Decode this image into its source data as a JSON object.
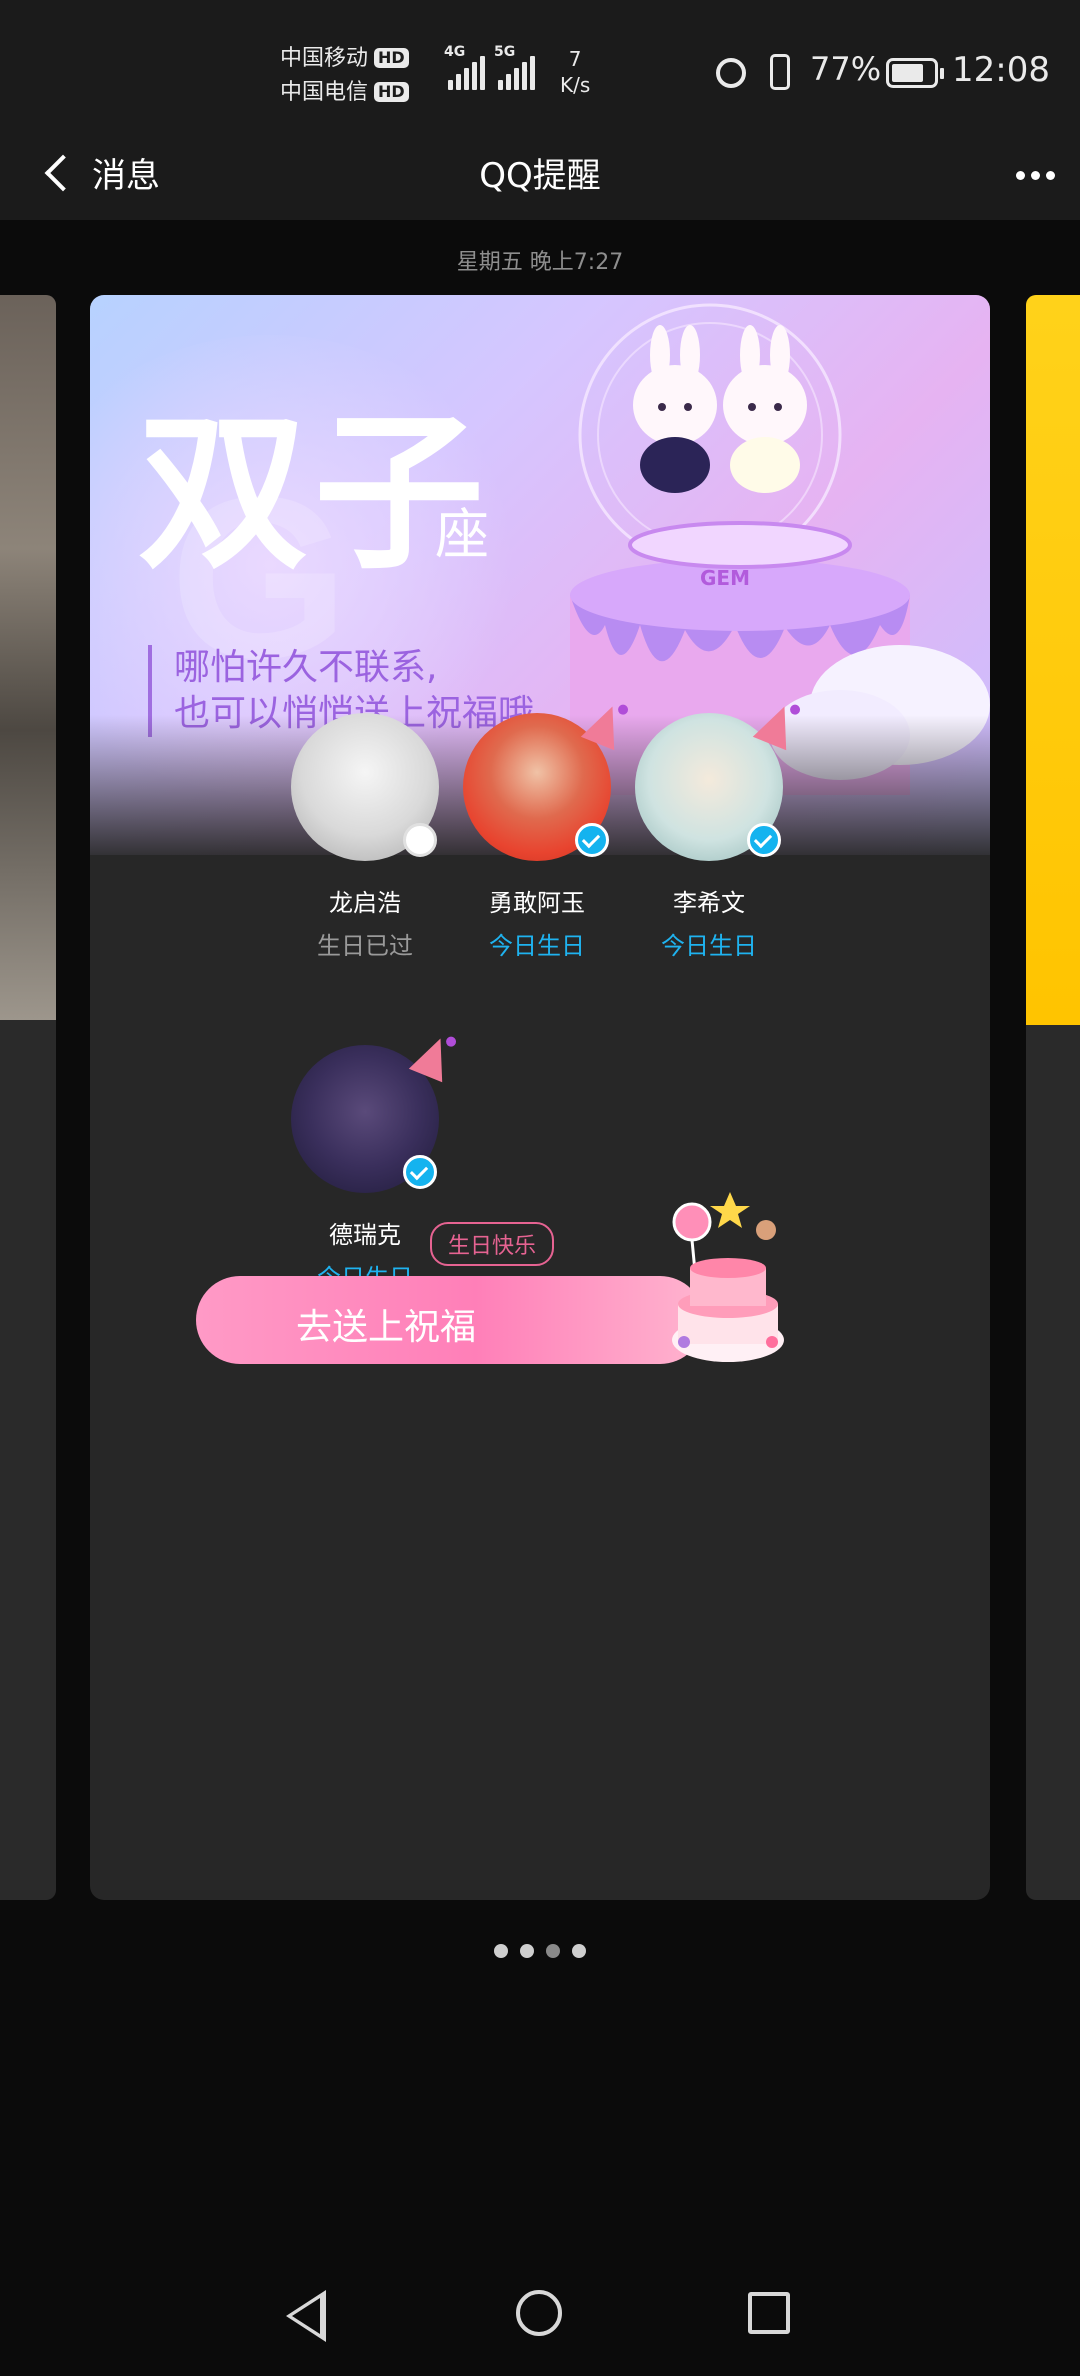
{
  "status_bar": {
    "carrier_1": "中国移动",
    "carrier_2": "中国电信",
    "hd_badge": "HD",
    "network_1": "4G",
    "network_2": "5G",
    "net_speed_value": "7",
    "net_speed_unit": "K/s",
    "battery_percent_text": "77%",
    "battery_level": 0.77,
    "time": "12:08"
  },
  "header": {
    "back_label": "消息",
    "title": "QQ提醒"
  },
  "timestamp": "星期五 晚上7:27",
  "card": {
    "zodiac": "双子",
    "zodiac_suffix": "座",
    "quote_line_1": "哪怕许久不联系,",
    "quote_line_2": "也可以悄悄送上祝福哦",
    "art_text": "GEM",
    "friends": [
      {
        "name": "龙启浩",
        "status": "生日已过",
        "selected": false
      },
      {
        "name": "勇敢阿玉",
        "status": "今日生日",
        "selected": true
      },
      {
        "name": "李希文",
        "status": "今日生日",
        "selected": true
      },
      {
        "name": "德瑞克",
        "status": "今日生日",
        "selected": true
      }
    ],
    "tag_label": "生日快乐",
    "cta_label": "去送上祝福"
  },
  "pager": {
    "count": 4,
    "active_index": 2
  },
  "colors": {
    "accent_blue": "#1fb3f0",
    "cta_pink": "#ff8fbf",
    "quote_purple": "#9b63e0",
    "background": "#0b0b0b"
  },
  "icons": [
    "back-chevron-icon",
    "more-icon",
    "alarm-icon",
    "vibrate-icon",
    "battery-icon",
    "check-icon",
    "party-hat-icon",
    "birthday-cake-icon",
    "nav-back-icon",
    "nav-home-icon",
    "nav-recent-icon"
  ]
}
